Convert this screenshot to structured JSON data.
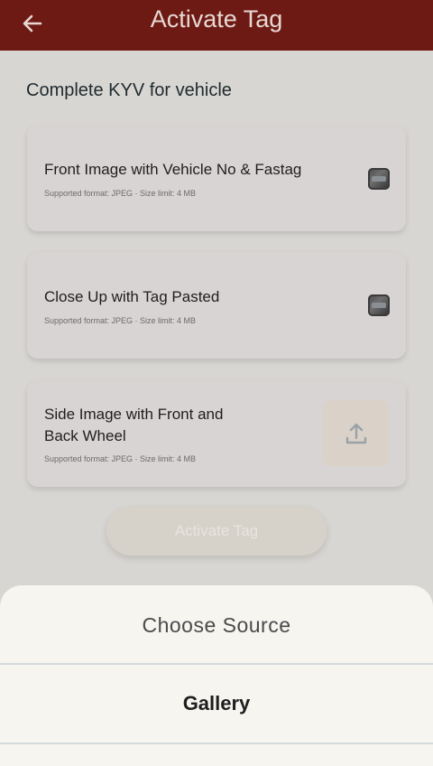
{
  "app_bar": {
    "title": "Activate Tag",
    "back_icon": "arrow-left-icon",
    "background": "#6e1a14"
  },
  "main": {
    "heading": "Complete KYV for vehicle",
    "cards": [
      {
        "title_line1": "Front Image with Vehicle No & Fastag",
        "title_line2": "",
        "meta": "Supported format: JPEG · Size limit: 4 MB",
        "state": "uploaded-thumbnail"
      },
      {
        "title_line1": "Close Up with Tag Pasted",
        "title_line2": "",
        "meta": "Supported format: JPEG · Size limit: 4 MB",
        "state": "uploaded-thumbnail"
      },
      {
        "title_line1": "Side Image with Front and",
        "title_line2": "Back Wheel",
        "meta": "Supported format: JPEG · Size limit: 4 MB",
        "state": "upload-icon"
      }
    ],
    "activate_button": "Activate Tag"
  },
  "sheet": {
    "title": "Choose Source",
    "options": [
      "Gallery"
    ]
  }
}
